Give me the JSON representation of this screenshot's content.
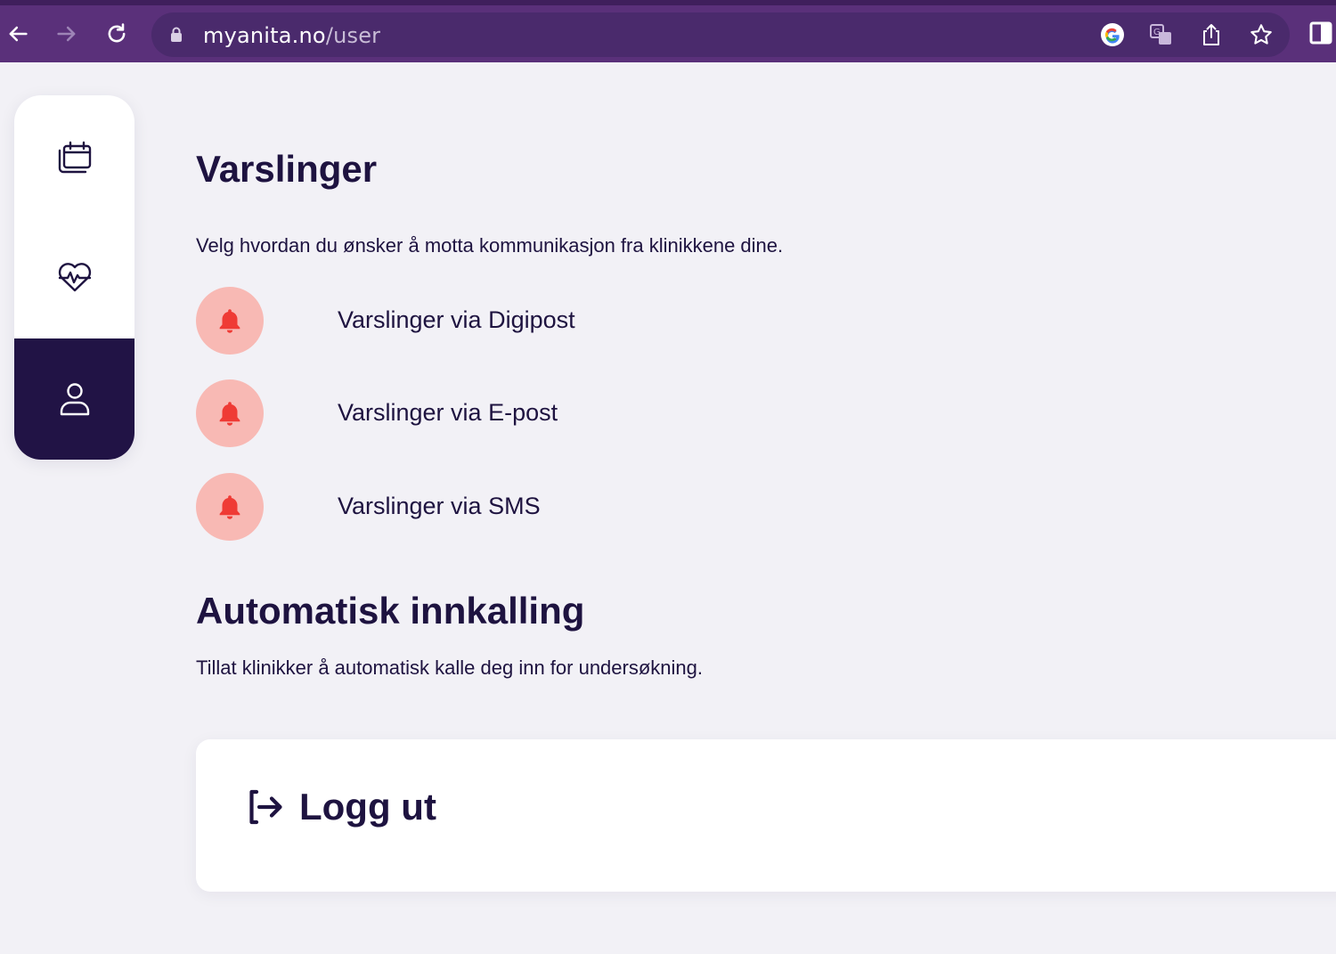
{
  "browser": {
    "url_host": "myanita.no",
    "url_path": "/user",
    "colors": {
      "bar": "#5a307a",
      "omnibox": "#4a2a6c"
    },
    "icons": [
      "back-icon",
      "forward-icon",
      "reload-icon",
      "lock-icon",
      "google-icon",
      "translate-icon",
      "share-icon",
      "star-icon",
      "side-panel-icon"
    ]
  },
  "sidebar": {
    "items": [
      {
        "icon": "calendar-icon",
        "active": false
      },
      {
        "icon": "heart-pulse-icon",
        "active": false
      },
      {
        "icon": "user-icon",
        "active": true
      }
    ],
    "colors": {
      "active_bg": "#211345"
    }
  },
  "notifications": {
    "title": "Varslinger",
    "description": "Velg hvordan du ønsker å motta kommunikasjon fra klinikkene dine.",
    "items": [
      {
        "label": "Varslinger via Digipost",
        "icon": "bell-icon"
      },
      {
        "label": "Varslinger via E-post",
        "icon": "bell-icon"
      },
      {
        "label": "Varslinger via SMS",
        "icon": "bell-icon"
      }
    ],
    "colors": {
      "bell": "#ef3b35",
      "bell_bg": "#f8b9b4"
    }
  },
  "auto_recall": {
    "title": "Automatisk innkalling",
    "description": "Tillat klinikker å automatisk kalle deg inn for undersøkning."
  },
  "logout": {
    "label": "Logg ut",
    "icon": "logout-icon"
  }
}
